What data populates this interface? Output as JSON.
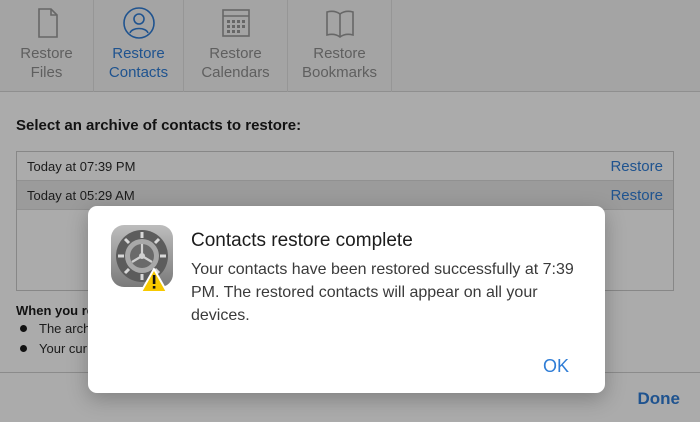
{
  "toolbar": {
    "items": [
      {
        "label": "Restore\nFiles",
        "icon": "file-icon",
        "active": false
      },
      {
        "label": "Restore\nContacts",
        "icon": "contacts-icon",
        "active": true
      },
      {
        "label": "Restore\nCalendars",
        "icon": "calendar-icon",
        "active": false
      },
      {
        "label": "Restore\nBookmarks",
        "icon": "bookmarks-icon",
        "active": false
      }
    ]
  },
  "main": {
    "heading": "Select an archive of contacts to restore:",
    "archives": [
      {
        "date": "Today at 07:39 PM",
        "action": "Restore"
      },
      {
        "date": "Today at 05:29 AM",
        "action": "Restore"
      }
    ],
    "note_title": "When you re",
    "notes": [
      "The arch",
      "Your cur"
    ],
    "done_label": "Done"
  },
  "dialog": {
    "icon": "settings-gear-warning-icon",
    "title": "Contacts restore complete",
    "message": "Your contacts have been restored successfully at 7:39 PM. The restored contacts will appear on all your devices.",
    "ok_label": "OK"
  },
  "colors": {
    "accent": "#2f7dd6",
    "warning": "#f7c900"
  }
}
